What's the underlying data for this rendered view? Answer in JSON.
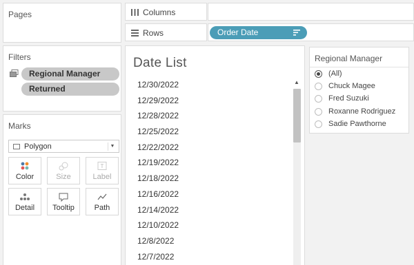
{
  "pages": {
    "title": "Pages"
  },
  "filters": {
    "title": "Filters",
    "pills": [
      "Regional Manager",
      "Returned"
    ]
  },
  "marks": {
    "title": "Marks",
    "mark_type": "Polygon",
    "buttons": [
      {
        "label": "Color",
        "icon": "color-dots-icon",
        "enabled": true
      },
      {
        "label": "Size",
        "icon": "size-icon",
        "enabled": false
      },
      {
        "label": "Label",
        "icon": "label-icon",
        "enabled": false
      },
      {
        "label": "Detail",
        "icon": "detail-icon",
        "enabled": true
      },
      {
        "label": "Tooltip",
        "icon": "tooltip-icon",
        "enabled": true
      },
      {
        "label": "Path",
        "icon": "path-icon",
        "enabled": true
      }
    ]
  },
  "shelves": {
    "columns_label": "Columns",
    "rows_label": "Rows",
    "rows_pill": "Order Date"
  },
  "view": {
    "title": "Date List",
    "dates": [
      "12/30/2022",
      "12/29/2022",
      "12/28/2022",
      "12/25/2022",
      "12/22/2022",
      "12/19/2022",
      "12/18/2022",
      "12/16/2022",
      "12/14/2022",
      "12/10/2022",
      "12/8/2022",
      "12/7/2022"
    ]
  },
  "quick_filter": {
    "title": "Regional Manager",
    "options": [
      {
        "label": "(All)",
        "selected": true
      },
      {
        "label": "Chuck Magee",
        "selected": false
      },
      {
        "label": "Fred Suzuki",
        "selected": false
      },
      {
        "label": "Roxanne Rodriguez",
        "selected": false
      },
      {
        "label": "Sadie Pawthorne",
        "selected": false
      }
    ]
  },
  "colors": {
    "rows_pill": "#4b9db7",
    "filter_pill": "#c8c8c8",
    "background": "#f2f2f2"
  }
}
